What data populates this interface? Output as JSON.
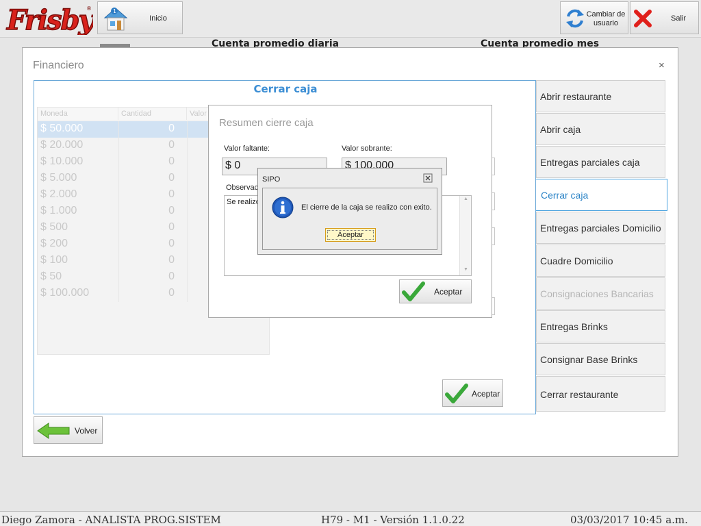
{
  "header": {
    "inicio_label": "Inicio",
    "cambiar_usuario_label": "Cambiar de usuario",
    "salir_label": "Salir"
  },
  "background": {
    "stat_daily": "Cuenta promedio diaria",
    "stat_month": "Cuenta promedio mes"
  },
  "dialog": {
    "title": "Financiero",
    "close_glyph": "×",
    "panel_title": "Cerrar caja",
    "grid": {
      "columns": [
        "Moneda",
        "Cantidad",
        "Valor"
      ],
      "rows": [
        {
          "moneda": "$ 50.000",
          "cantidad": "0"
        },
        {
          "moneda": "$ 20.000",
          "cantidad": "0"
        },
        {
          "moneda": "$ 10.000",
          "cantidad": "0"
        },
        {
          "moneda": "$ 5.000",
          "cantidad": "0"
        },
        {
          "moneda": "$ 2.000",
          "cantidad": "0"
        },
        {
          "moneda": "$ 1.000",
          "cantidad": "0"
        },
        {
          "moneda": "$ 500",
          "cantidad": "0"
        },
        {
          "moneda": "$ 200",
          "cantidad": "0"
        },
        {
          "moneda": "$ 100",
          "cantidad": "0"
        },
        {
          "moneda": "$ 50",
          "cantidad": "0"
        },
        {
          "moneda": "$ 100.000",
          "cantidad": "0"
        }
      ]
    },
    "panel_accept_label": "Aceptar",
    "volver_label": "Volver"
  },
  "menu": {
    "items": [
      {
        "label": "Abrir restaurante"
      },
      {
        "label": "Abrir caja"
      },
      {
        "label": "Entregas parciales caja"
      },
      {
        "label": "Cerrar caja"
      },
      {
        "label": "Entregas parciales Domicilio"
      },
      {
        "label": "Cuadre Domicilio"
      },
      {
        "label": "Consignaciones Bancarias"
      },
      {
        "label": "Entregas Brinks"
      },
      {
        "label": "Consignar Base Brinks"
      },
      {
        "label": "Cerrar restaurante"
      }
    ]
  },
  "resumen": {
    "title": "Resumen cierre caja",
    "valor_faltante_label": "Valor faltante:",
    "valor_faltante_value": "$ 0",
    "valor_sobrante_label": "Valor sobrante:",
    "valor_sobrante_value": "$ 100.000",
    "observaciones_label": "Observac",
    "observaciones_value": "Se realizo",
    "accept_label": "Aceptar"
  },
  "sipo": {
    "title": "SIPO",
    "message": "El cierre de la caja se realizo con exito.",
    "ok_label": "Aceptar"
  },
  "status": {
    "user": "Diego Zamora - ANALISTA PROG.SISTEM",
    "version": "H79 - M1  -  Versión 1.1.0.22",
    "datetime": "03/03/2017 10:45 a.m."
  },
  "colors": {
    "accent": "#3c8ed4",
    "logo_red": "#d9221c"
  }
}
